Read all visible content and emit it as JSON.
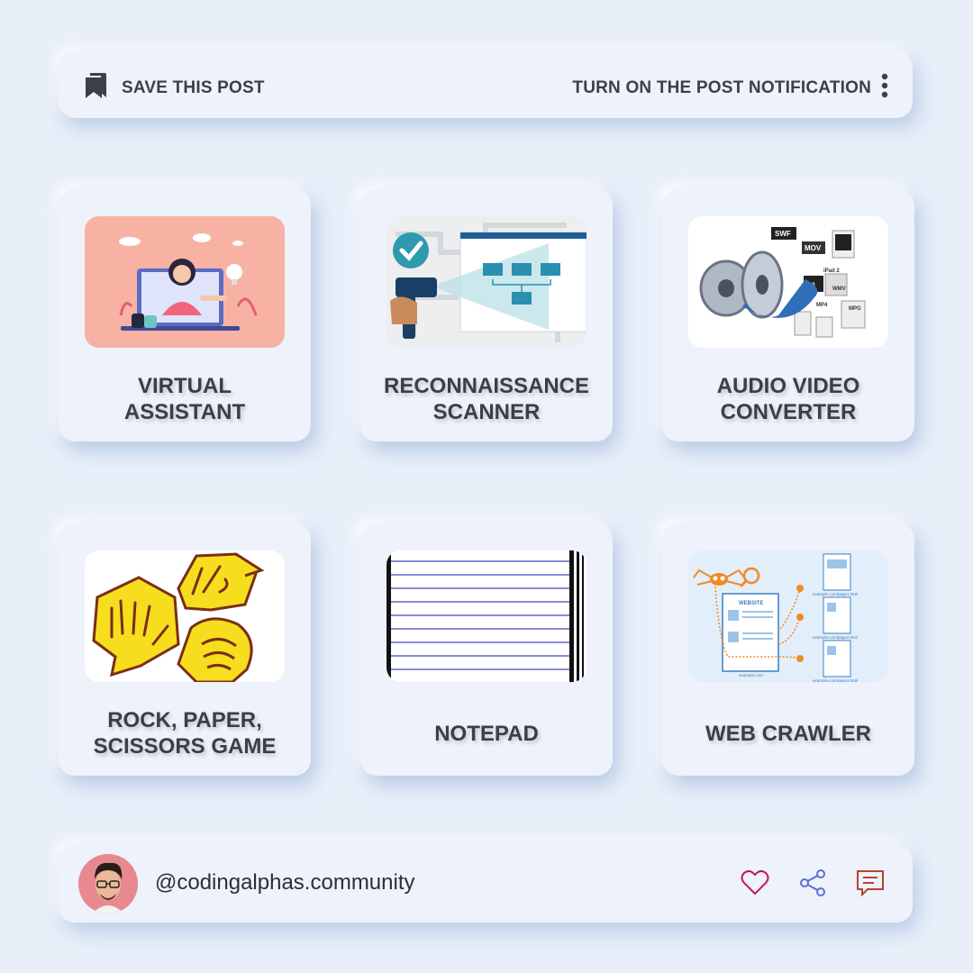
{
  "header": {
    "save_label": "SAVE THIS POST",
    "notification_label": "TURN ON THE POST NOTIFICATION",
    "icons": [
      "bookmark-icon",
      "more-vertical-icon"
    ]
  },
  "cards": [
    {
      "title": "VIRTUAL\nASSISTANT",
      "image": "virtual-assistant-illustration"
    },
    {
      "title": "RECONNAISSANCE\nSCANNER",
      "image": "barcode-scanner-illustration"
    },
    {
      "title": "AUDIO VIDEO\nCONVERTER",
      "image": "film-reel-formats-illustration",
      "image_labels": [
        "SWF",
        "MOV",
        "AVI",
        "WMV",
        "MP4",
        "MPG",
        "iPad 2"
      ]
    },
    {
      "title": "ROCK, PAPER,\nSCISSORS GAME",
      "image": "rock-paper-scissors-hands-illustration"
    },
    {
      "title": "NOTEPAD",
      "image": "lined-paper-illustration"
    },
    {
      "title": "WEB CRAWLER",
      "image": "spider-crawling-pages-illustration",
      "image_labels": [
        "WEBSITE",
        "example.com/page1.html",
        "example.com/page2.html",
        "example.com/page3.html",
        "example.com"
      ]
    }
  ],
  "footer": {
    "username": "@codingalphas.community",
    "icons": [
      "heart-icon",
      "share-icon",
      "comment-icon"
    ]
  },
  "colors": {
    "background": "#e8eff9",
    "card": "#edf2fb",
    "text": "#3a3f47",
    "heart": "#c2185b",
    "share": "#5b6fd6",
    "comment": "#b5442e"
  }
}
